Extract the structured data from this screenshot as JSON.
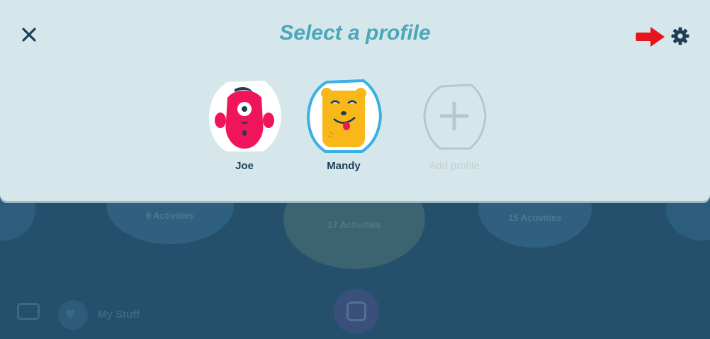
{
  "modal": {
    "title": "Select a profile",
    "close_icon": "close-icon",
    "settings_icon": "gear-icon",
    "annotation_arrow_color": "#e8141c"
  },
  "profiles": [
    {
      "name": "Joe",
      "avatar": "pink-one-eyed-monster",
      "color": "#f0145a",
      "selected": false
    },
    {
      "name": "Mandy",
      "avatar": "yellow-bear",
      "color": "#f9b81a",
      "selected": true
    }
  ],
  "add_profile": {
    "label": "Add profile",
    "icon": "plus-icon"
  },
  "background": {
    "cards": [
      {
        "label": "9 Activities"
      },
      {
        "label": "17 Activities"
      },
      {
        "label": "15 Activities"
      }
    ],
    "bottom_nav": {
      "my_stuff_label": "My Stuff"
    }
  },
  "colors": {
    "modal_bg": "#d6e7ec",
    "title": "#4aa8b8",
    "dark_text": "#1e3e57",
    "selected_ring": "#3ab0e3"
  }
}
